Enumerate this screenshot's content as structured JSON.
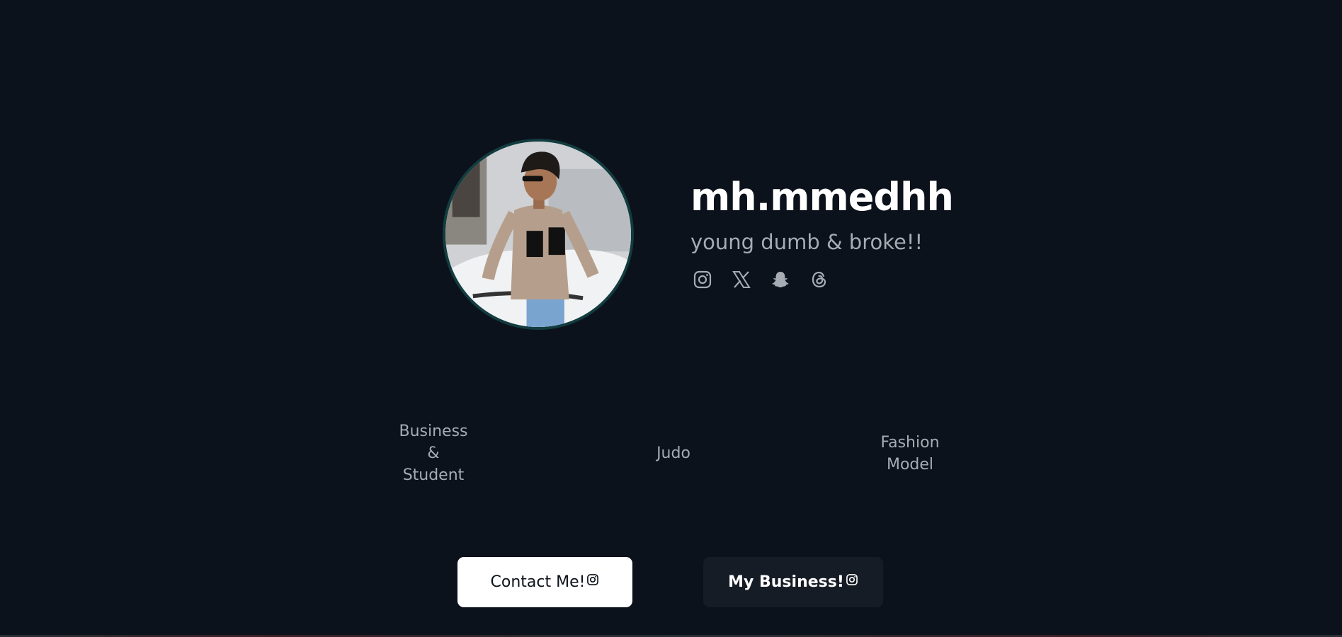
{
  "profile": {
    "username": "mh.mmedhh",
    "tagline": "young dumb & broke!!",
    "avatar_alt": "profile photo"
  },
  "socials": [
    {
      "name": "instagram",
      "icon": "instagram-icon"
    },
    {
      "name": "x",
      "icon": "x-icon"
    },
    {
      "name": "snapchat",
      "icon": "snapchat-icon"
    },
    {
      "name": "threads",
      "icon": "threads-icon"
    }
  ],
  "roles": [
    {
      "label": "Business\n&\nStudent"
    },
    {
      "label": "Judo"
    },
    {
      "label": "Fashion\nModel"
    }
  ],
  "buttons": {
    "contact_label": "Contact Me!",
    "business_label": "My Business!"
  },
  "colors": {
    "background": "#0c121b",
    "avatar_ring": "#123c3f",
    "muted_text": "#a6abb4",
    "secondary_button": "#161c25"
  }
}
